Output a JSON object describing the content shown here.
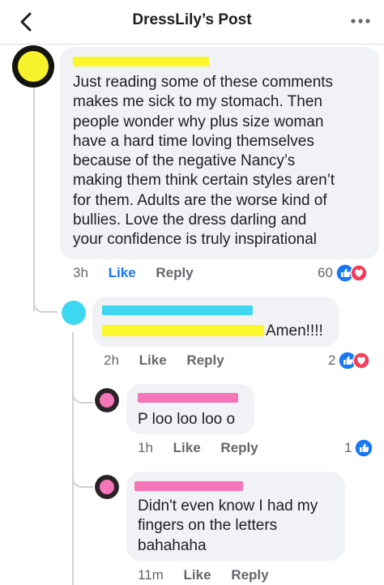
{
  "header": {
    "title": "DressLily’s Post",
    "back_icon": "chevron-left-icon",
    "more_icon": "ellipsis-icon"
  },
  "colors": {
    "like_blue": "#1877f2",
    "love_red": "#f33e58",
    "bubble_bg": "#f0f2f5",
    "muted_text": "#65676b",
    "highlight_yellow": "#fcf72a",
    "highlight_cyan": "#3ed6f0",
    "highlight_pink": "#f475b8"
  },
  "comments": [
    {
      "text": "Just reading some of these comments makes me sick to my stomach. Then people wonder why plus size woman have a hard time loving themselves because of the negative Nancy’s making them think certain styles aren’t for them. Adults are the worse kind of bullies. Love the dress darling and your confidence is truly inspirational",
      "lines": [
        "Just reading some of these comments",
        "makes me sick to my stomach. Then",
        "people wonder why plus size woman",
        "have a hard time loving themselves",
        "because of the negative Nancy’s",
        "making them think certain styles aren’t",
        "for them. Adults are the worse kind of",
        "bullies. Love the dress darling and",
        "your confidence is truly inspirational"
      ],
      "time": "3h",
      "like_label": "Like",
      "reply_label": "Reply",
      "reaction_count": "60",
      "reactions": [
        "like",
        "love"
      ]
    },
    {
      "text": "Amen!!!!",
      "time": "2h",
      "like_label": "Like",
      "reply_label": "Reply",
      "reaction_count": "2",
      "reactions": [
        "like",
        "love"
      ]
    },
    {
      "text": "P loo loo loo o",
      "time": "1h",
      "like_label": "Like",
      "reply_label": "Reply",
      "reaction_count": "1",
      "reactions": [
        "like"
      ]
    },
    {
      "text": "Didn't even know I had my fingers on the letters bahahaha",
      "lines": [
        "Didn't even know I had my",
        "fingers on the letters",
        "bahahaha"
      ],
      "time": "11m",
      "like_label": "Like",
      "reply_label": "Reply"
    }
  ]
}
